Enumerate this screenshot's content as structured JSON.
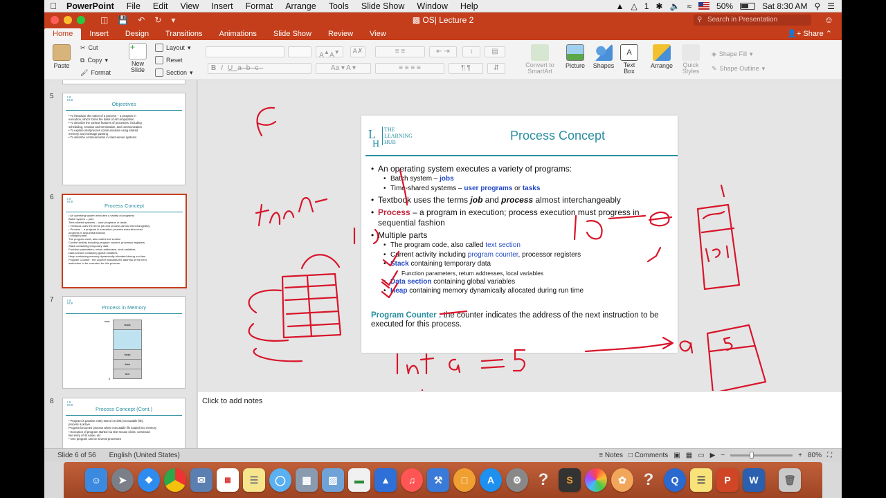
{
  "menubar": {
    "app_name": "PowerPoint",
    "items": [
      "File",
      "Edit",
      "View",
      "Insert",
      "Format",
      "Arrange",
      "Tools",
      "Slide Show",
      "Window",
      "Help"
    ],
    "battery": "50%",
    "clock": "Sat 8:30 AM",
    "status_num": "1"
  },
  "window": {
    "title": "OS| Lecture 2",
    "search_placeholder": "Search in Presentation"
  },
  "ribbon": {
    "tabs": [
      "Home",
      "Insert",
      "Design",
      "Transitions",
      "Animations",
      "Slide Show",
      "Review",
      "View"
    ],
    "share": "Share",
    "paste": "Paste",
    "cut": "Cut",
    "copy": "Copy",
    "format": "Format",
    "new_slide": "New Slide",
    "layout": "Layout",
    "reset": "Reset",
    "section": "Section",
    "convert_smartart": "Convert to SmartArt",
    "picture": "Picture",
    "shapes": "Shapes",
    "text_box": "Text Box",
    "arrange": "Arrange",
    "quick_styles": "Quick Styles",
    "shape_fill": "Shape Fill",
    "shape_outline": "Shape Outline"
  },
  "thumbnails": [
    {
      "num": "5",
      "title": "Objectives",
      "lines": [
        "• To introduce the notion of a process -- a program in",
        "  execution, which forms the basis of all computation",
        "• To describe the various features of processes, including",
        "  scheduling, creation and termination, and communication",
        "• To explore interprocess communication using shared",
        "  memory and message passing",
        "• To describe communication in client-server systems"
      ]
    },
    {
      "num": "6",
      "title": "Process Concept",
      "lines": [
        "• An operating system executes a variety of programs:",
        "    Batch system -- jobs",
        "    Time-shared systems -- user programs or tasks",
        "• Textbook uses the terms job and process almost interchangeably",
        "• Process -- a program in execution; process execution must",
        "  progress in sequential fashion",
        "• Multiple parts",
        "    The program code, also called text section",
        "    Current activity including program counter, processor registers",
        "    Stack containing temporary data",
        "      Function parameters, return addresses, local variables",
        "    Data section containing global variables",
        "    Heap containing memory dynamically allocated during run time",
        "",
        "Program Counter : the counter indicates the address of the next",
        "  instruction to be executed for this process."
      ]
    },
    {
      "num": "7",
      "title": "Process in Memory",
      "mem": [
        "stack",
        "",
        "heap",
        "data",
        "text"
      ],
      "max": "max",
      "zero": "0"
    },
    {
      "num": "8",
      "title": "Process Concept (Cont.)",
      "lines": [
        "• Program is passive entity stored on disk (executable file),",
        "  process is active",
        "    Program becomes process when executable file loaded into memory",
        "• Execution of program started via GUI mouse clicks, command",
        "  line entry of its name, etc",
        "• One program can be several processes"
      ]
    }
  ],
  "slide": {
    "logo_words": [
      "THE",
      "LEARNING",
      "HUB"
    ],
    "title": "Process Concept",
    "b1_intro": "An operating system executes a variety of programs:",
    "batch_pre": "Batch system – ",
    "batch_kw": "jobs",
    "ts_pre": "Time-shared systems – ",
    "ts_kw1": "user programs",
    "ts_or": " or ",
    "ts_kw2": "tasks",
    "tb_pre": "Textbook uses the terms ",
    "tb_job": "job",
    "tb_and": " and ",
    "tb_proc": "process",
    "tb_post": " almost interchangeably",
    "proc_kw": "Process",
    "proc_post": " – a program in execution; process execution must progress in sequential fashion",
    "multi": "Multiple parts",
    "p1_pre": "The program code, also called ",
    "p1_kw": "text section",
    "p2_pre": "Current activity including ",
    "p2_kw": "program counter",
    "p2_post": ", processor registers",
    "p3_kw": "Stack",
    "p3_post": " containing temporary data",
    "p3_sub": "Function parameters, return addresses, local variables",
    "p4_kw": "Data section",
    "p4_post": " containing global variables",
    "p5_kw": "Heap",
    "p5_post": " containing memory dynamically allocated during run time",
    "pc_label": "Program Counter :",
    "pc_text": " the counter indicates the address of the next instruction to be executed for this process."
  },
  "notes_placeholder": "Click to add notes",
  "statusbar": {
    "slide_info": "Slide 6 of 56",
    "language": "English (United States)",
    "notes": "Notes",
    "comments": "Comments",
    "zoom": "80%"
  },
  "colors": {
    "accent": "#c43e1c",
    "teal": "#2a8ea0",
    "ink": "#d8152a"
  }
}
